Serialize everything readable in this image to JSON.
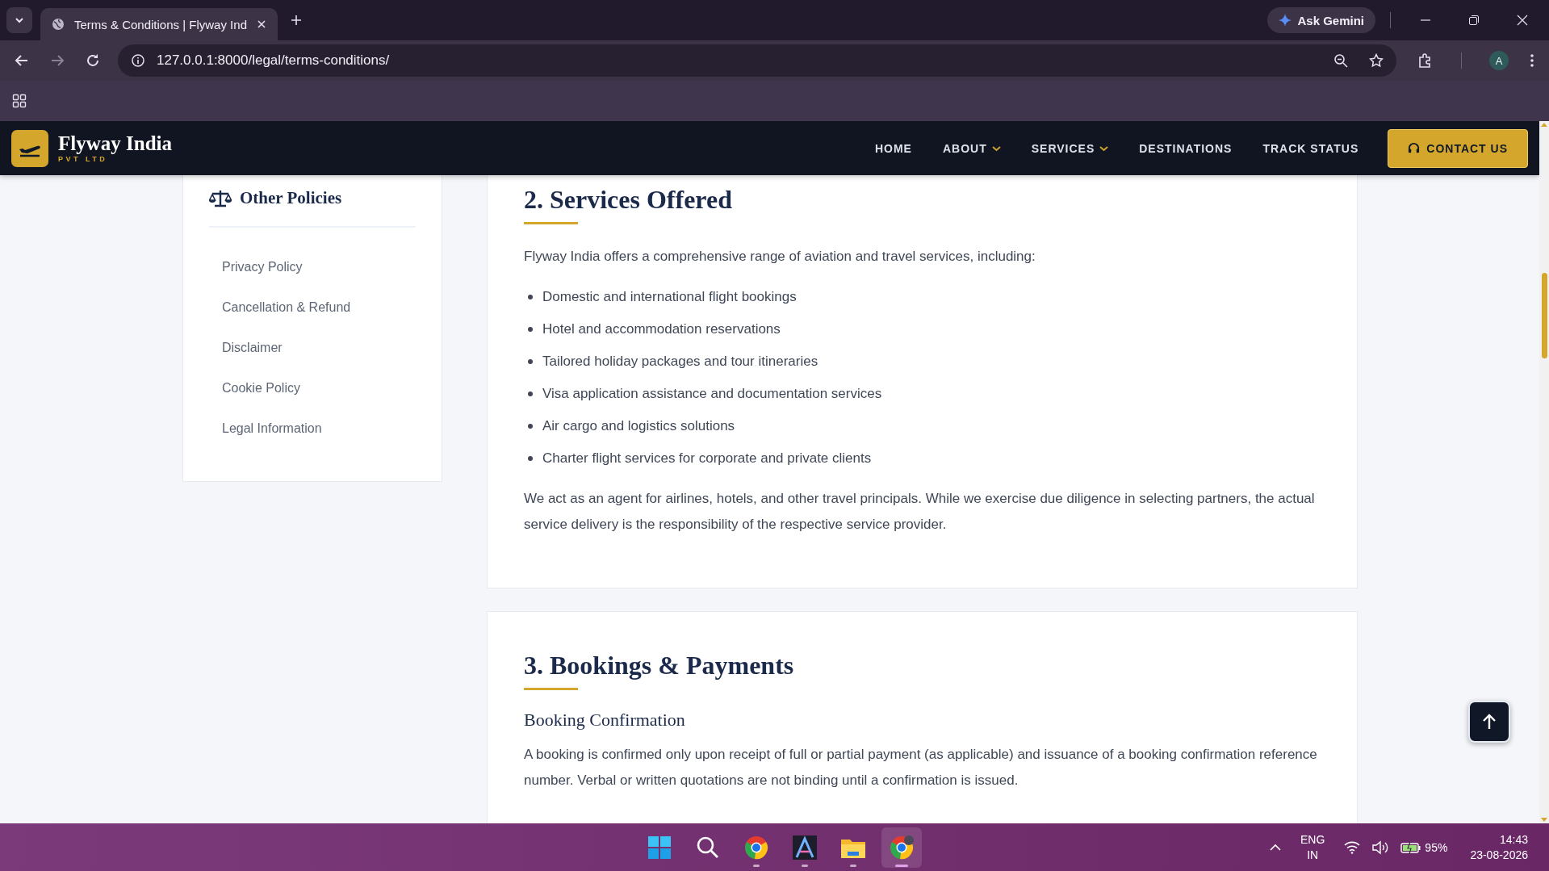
{
  "browser": {
    "tabs": [
      {
        "title": "Terms & Conditions | Flyway Ind",
        "selected": true
      }
    ],
    "url": "127.0.0.1:8000/legal/terms-conditions/",
    "ask_gemini": "Ask Gemini",
    "profile": "A"
  },
  "site": {
    "brand": "Flyway India",
    "tagline": "PVT LTD",
    "nav": [
      {
        "label": "HOME",
        "dropdown": false
      },
      {
        "label": "ABOUT",
        "dropdown": true
      },
      {
        "label": "SERVICES",
        "dropdown": true
      },
      {
        "label": "DESTINATIONS",
        "dropdown": false
      },
      {
        "label": "TRACK STATUS",
        "dropdown": false
      }
    ],
    "contact": "CONTACT US"
  },
  "sidebar": {
    "title": "Other Policies",
    "items": [
      "Privacy Policy",
      "Cancellation & Refund",
      "Disclaimer",
      "Cookie Policy",
      "Legal Information"
    ]
  },
  "sections": [
    {
      "title": "2. Services Offered",
      "blocks": [
        {
          "kind": "paragraph",
          "text": "Flyway India offers a comprehensive range of aviation and travel services, including:"
        },
        {
          "kind": "list",
          "items": [
            "Domestic and international flight bookings",
            "Hotel and accommodation reservations",
            "Tailored holiday packages and tour itineraries",
            "Visa application assistance and documentation services",
            "Air cargo and logistics solutions",
            "Charter flight services for corporate and private clients"
          ]
        },
        {
          "kind": "paragraph",
          "text": "We act as an agent for airlines, hotels, and other travel principals. While we exercise due diligence in selecting partners, the actual service delivery is the responsibility of the respective service provider."
        }
      ]
    },
    {
      "title": "3. Bookings & Payments",
      "blocks": [
        {
          "kind": "subheading",
          "text": "Booking Confirmation"
        },
        {
          "kind": "paragraph",
          "text": "A booking is confirmed only upon receipt of full or partial payment (as applicable) and issuance of a booking confirmation reference number. Verbal or written quotations are not binding until a confirmation is issued."
        }
      ]
    }
  ],
  "taskbar": {
    "apps": [
      {
        "kind": "start",
        "running": false,
        "selected": false
      },
      {
        "kind": "search",
        "running": false,
        "selected": false
      },
      {
        "kind": "chrome",
        "running": true,
        "selected": false
      },
      {
        "kind": "editor",
        "running": true,
        "selected": false
      },
      {
        "kind": "folder",
        "running": true,
        "selected": false
      },
      {
        "kind": "chrome-profile",
        "running": true,
        "selected": true
      }
    ],
    "language": "ENG",
    "region": "IN",
    "battery": "95%",
    "time": "14:43",
    "date": "23-08-2026"
  }
}
